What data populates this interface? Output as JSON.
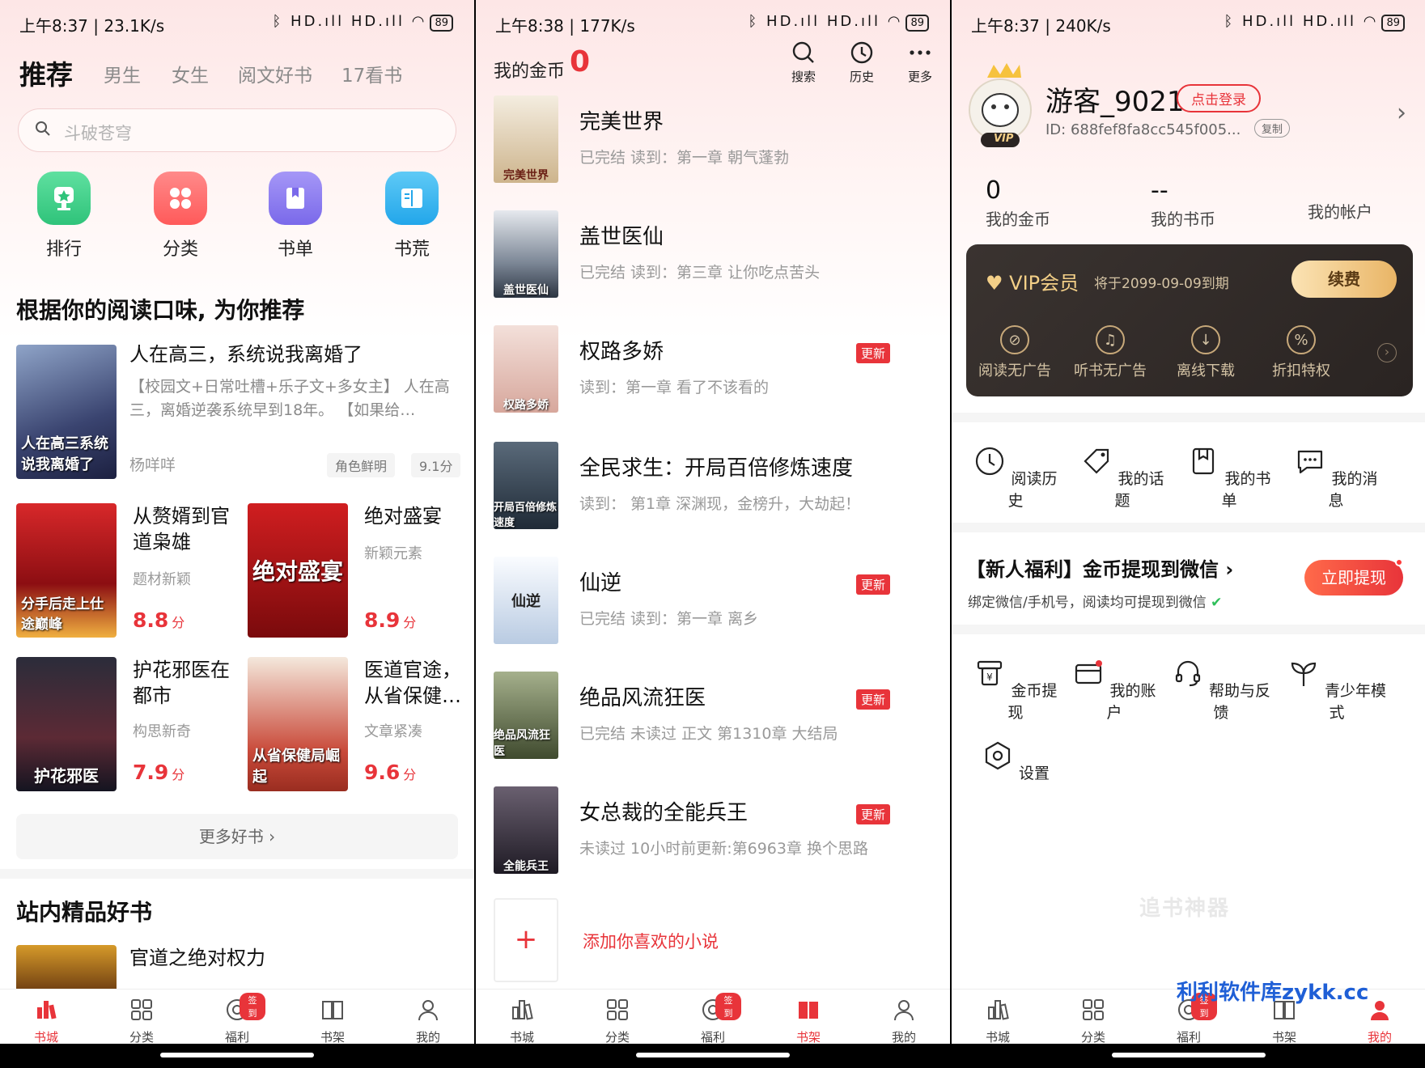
{
  "panel1": {
    "status": {
      "time": "上午8:37 | 23.1K/s",
      "battery": "89",
      "signal": "ᛒ HD.ıll HD.ıll ◠"
    },
    "tabs": [
      "推荐",
      "男生",
      "女生",
      "阅文好书",
      "17看书"
    ],
    "search_placeholder": "斗破苍穹",
    "quick": [
      {
        "label": "排行",
        "icon": "trophy-icon",
        "color": "#3fd08a"
      },
      {
        "label": "分类",
        "icon": "grid-icon",
        "color": "#ff6b6b"
      },
      {
        "label": "书单",
        "icon": "booklist-icon",
        "color": "#8b7cf0"
      },
      {
        "label": "书荒",
        "icon": "book-icon",
        "color": "#36b6f0"
      }
    ],
    "recommend_title": "根据你的阅读口味, 为你推荐",
    "featured": {
      "title": "人在高三，系统说我离婚了",
      "desc": "【校园文+日常吐槽+乐子文+多女主】 人在高三，离婚逆袭系统早到18年。 【如果给…",
      "author": "杨咩咩",
      "tag": "角色鲜明",
      "score": "9.1分",
      "cover_text": "人在高三系统说我离婚了"
    },
    "grid_books": [
      {
        "title": "从赘婿到官道枭雄",
        "tag": "题材新颖",
        "score": "8.8",
        "unit": "分",
        "cover_text": "分手后走上仕途巅峰"
      },
      {
        "title": "绝对盛宴",
        "tag": "新颖元素",
        "score": "8.9",
        "unit": "分",
        "cover_text": "绝对盛宴"
      },
      {
        "title": "护花邪医在都市",
        "tag": "构思新奇",
        "score": "7.9",
        "unit": "分",
        "cover_text": "护花邪医"
      },
      {
        "title": "医道官途，从省保健…",
        "tag": "文章紧凑",
        "score": "9.6",
        "unit": "分",
        "cover_text": "从省保健局崛起"
      }
    ],
    "more_label": "更多好书 ›",
    "premium_title": "站内精品好书",
    "premium_book": "官道之绝对权力"
  },
  "nav": [
    "书城",
    "分类",
    "福利",
    "书架",
    "我的"
  ],
  "nav_badge": "签到",
  "panel2": {
    "status": {
      "time": "上午8:38 | 177K/s",
      "battery": "89"
    },
    "coins_label": "我的金币",
    "coins_value": "0",
    "header_actions": [
      {
        "label": "搜索",
        "icon": "search-icon"
      },
      {
        "label": "历史",
        "icon": "clock-icon"
      },
      {
        "label": "更多",
        "icon": "more-icon"
      }
    ],
    "books": [
      {
        "title": "完美世界",
        "desc": "已完结  读到：第一章 朝气蓬勃",
        "updated": false,
        "cover": "#e9e1d1",
        "cover_text": "完美世界"
      },
      {
        "title": "盖世医仙",
        "desc": "已完结  读到：第三章  让你吃点苦头",
        "updated": false,
        "cover": "#9aa3ad",
        "cover_text": "盖世医仙"
      },
      {
        "title": "权路多娇",
        "desc": "读到：第一章 看了不该看的",
        "updated": true,
        "cover": "#e6c6bd",
        "cover_text": "权路多娇"
      },
      {
        "title": "全民求生：开局百倍修炼速度",
        "desc": "读到：  第1章 深渊现，金榜升，大劫起！",
        "updated": false,
        "cover": "#3a4350",
        "cover_text": "开局百倍修炼速度"
      },
      {
        "title": "仙逆",
        "desc": "已完结  读到：第一章  离乡",
        "updated": true,
        "cover": "#e3eaf3",
        "cover_text": "仙逆"
      },
      {
        "title": "绝品风流狂医",
        "desc": "已完结  未读过  正文 第1310章 大结局",
        "updated": true,
        "cover": "#6f7a5c",
        "cover_text": "绝品风流狂医"
      },
      {
        "title": "女总裁的全能兵王",
        "desc": "未读过  10小时前更新:第6963章 换个思路",
        "updated": true,
        "cover": "#3a3540",
        "cover_text": "全能兵王"
      }
    ],
    "update_label": "更新",
    "add_label": "添加你喜欢的小说"
  },
  "panel3": {
    "status": {
      "time": "上午8:37 | 240K/s",
      "battery": "89"
    },
    "username": "游客_9021",
    "login_btn": "点击登录",
    "user_id": "ID: 688fef8fa8cc545f005...",
    "copy_btn": "复制",
    "vip_badge": "VIP",
    "stats": [
      {
        "value": "0",
        "label": "我的金币"
      },
      {
        "value": "--",
        "label": "我的书币"
      },
      {
        "value": "",
        "label": "我的帐户"
      }
    ],
    "vip": {
      "title": "VIP会员",
      "expiry": "将于2099-09-09到期",
      "renew": "续费",
      "features": [
        "阅读无广告",
        "听书无广告",
        "离线下载",
        "折扣特权"
      ]
    },
    "shortcuts": [
      {
        "label": "阅读历史",
        "icon": "clock-icon"
      },
      {
        "label": "我的话题",
        "icon": "tag-icon"
      },
      {
        "label": "我的书单",
        "icon": "booklist-icon"
      },
      {
        "label": "我的消息",
        "icon": "message-icon"
      }
    ],
    "promo": {
      "title": "【新人福利】金币提现到微信 ›",
      "desc": "绑定微信/手机号，阅读均可提现到微信",
      "button": "立即提现"
    },
    "tools": [
      {
        "label": "金币提现",
        "icon": "withdraw-icon"
      },
      {
        "label": "我的账户",
        "icon": "wallet-icon"
      },
      {
        "label": "帮助与反馈",
        "icon": "headset-icon"
      },
      {
        "label": "青少年模式",
        "icon": "sprout-icon"
      },
      {
        "label": "设置",
        "icon": "settings-icon"
      }
    ],
    "watermark": "追书神器",
    "site_watermark": "利利软件库zykk.cc"
  }
}
